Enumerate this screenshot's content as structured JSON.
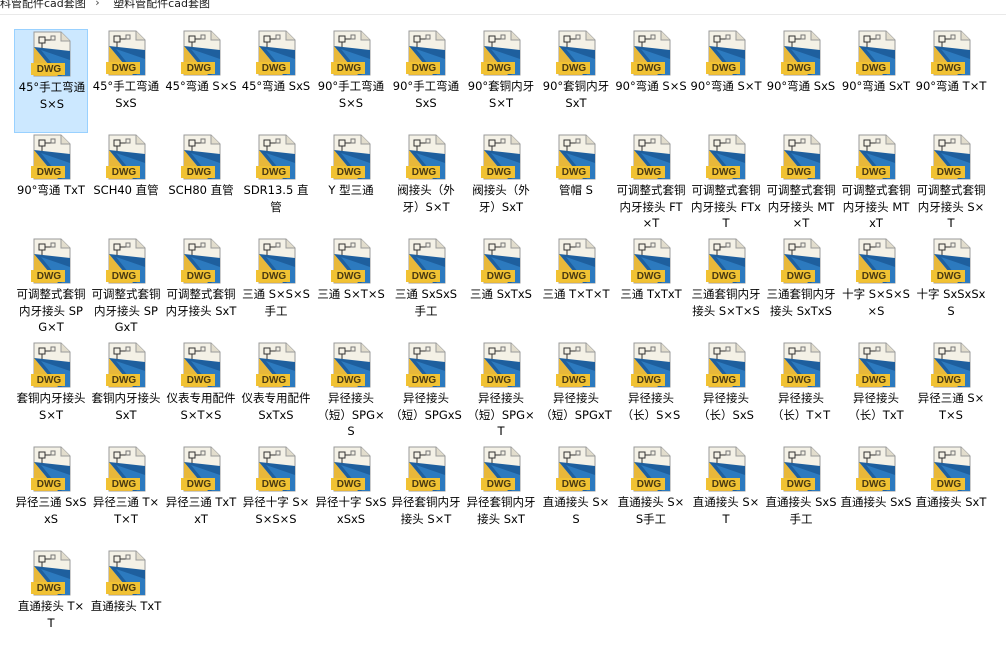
{
  "breadcrumb": [
    "科管配件cad套图",
    "塑料管配件cad套图"
  ],
  "icon_badge": "DWG",
  "selected_index": 0,
  "files": [
    "45°手工弯通 S×S",
    "45°手工弯通 SxS",
    "45°弯通 S×S",
    "45°弯通 SxS",
    "90°手工弯通 S×S",
    "90°手工弯通 SxS",
    "90°套铜内牙 S×T",
    "90°套铜内牙 SxT",
    "90°弯通 S×S",
    "90°弯通 S×T",
    "90°弯通 SxS",
    "90°弯通 SxT",
    "90°弯通 T×T",
    "90°弯通 TxT",
    "SCH40 直管",
    "SCH80 直管",
    "SDR13.5 直管",
    "Y 型三通",
    "阀接头（外牙）S×T",
    "阀接头（外牙）SxT",
    "管帽 S",
    "可调整式套铜内牙接头 FT×T",
    "可调整式套铜内牙接头 FTxT",
    "可调整式套铜内牙接头 MT×T",
    "可调整式套铜内牙接头 MTxT",
    "可调整式套铜内牙接头 S×T",
    "可调整式套铜内牙接头 SPG×T",
    "可调整式套铜内牙接头 SPGxT",
    "可调整式套铜内牙接头 SxT",
    "三通 S×S×S 手工",
    "三通 S×T×S",
    "三通 SxSxS 手工",
    "三通 SxTxS",
    "三通 T×T×T",
    "三通 TxTxT",
    "三通套铜内牙接头 S×T×S",
    "三通套铜内牙接头 SxTxS",
    "十字 S×S×S×S",
    "十字 SxSxSxS",
    "套铜内牙接头 S×T",
    "套铜内牙接头 SxT",
    "仪表专用配件 S×T×S",
    "仪表专用配件 SxTxS",
    "异径接头（短）SPG×S",
    "异径接头（短）SPGxS",
    "异径接头（短）SPG×T",
    "异径接头（短）SPGxT",
    "异径接头（长）S×S",
    "异径接头（长）SxS",
    "异径接头（长）T×T",
    "异径接头（长）TxT",
    "异径三通 S×T×S",
    "异径三通 SxSxS",
    "异径三通 T×T×T",
    "异径三通 TxTxT",
    "异径十字 S×S×S×S",
    "异径十字 SxSxSxS",
    "异径套铜内牙接头 S×T",
    "异径套铜内牙接头 SxT",
    "直通接头 S×S",
    "直通接头 S×S手工",
    "直通接头 S×T",
    "直通接头 SxS 手工",
    "直通接头 SxS",
    "直通接头 SxT",
    "直通接头 T×T",
    "直通接头 TxT"
  ]
}
